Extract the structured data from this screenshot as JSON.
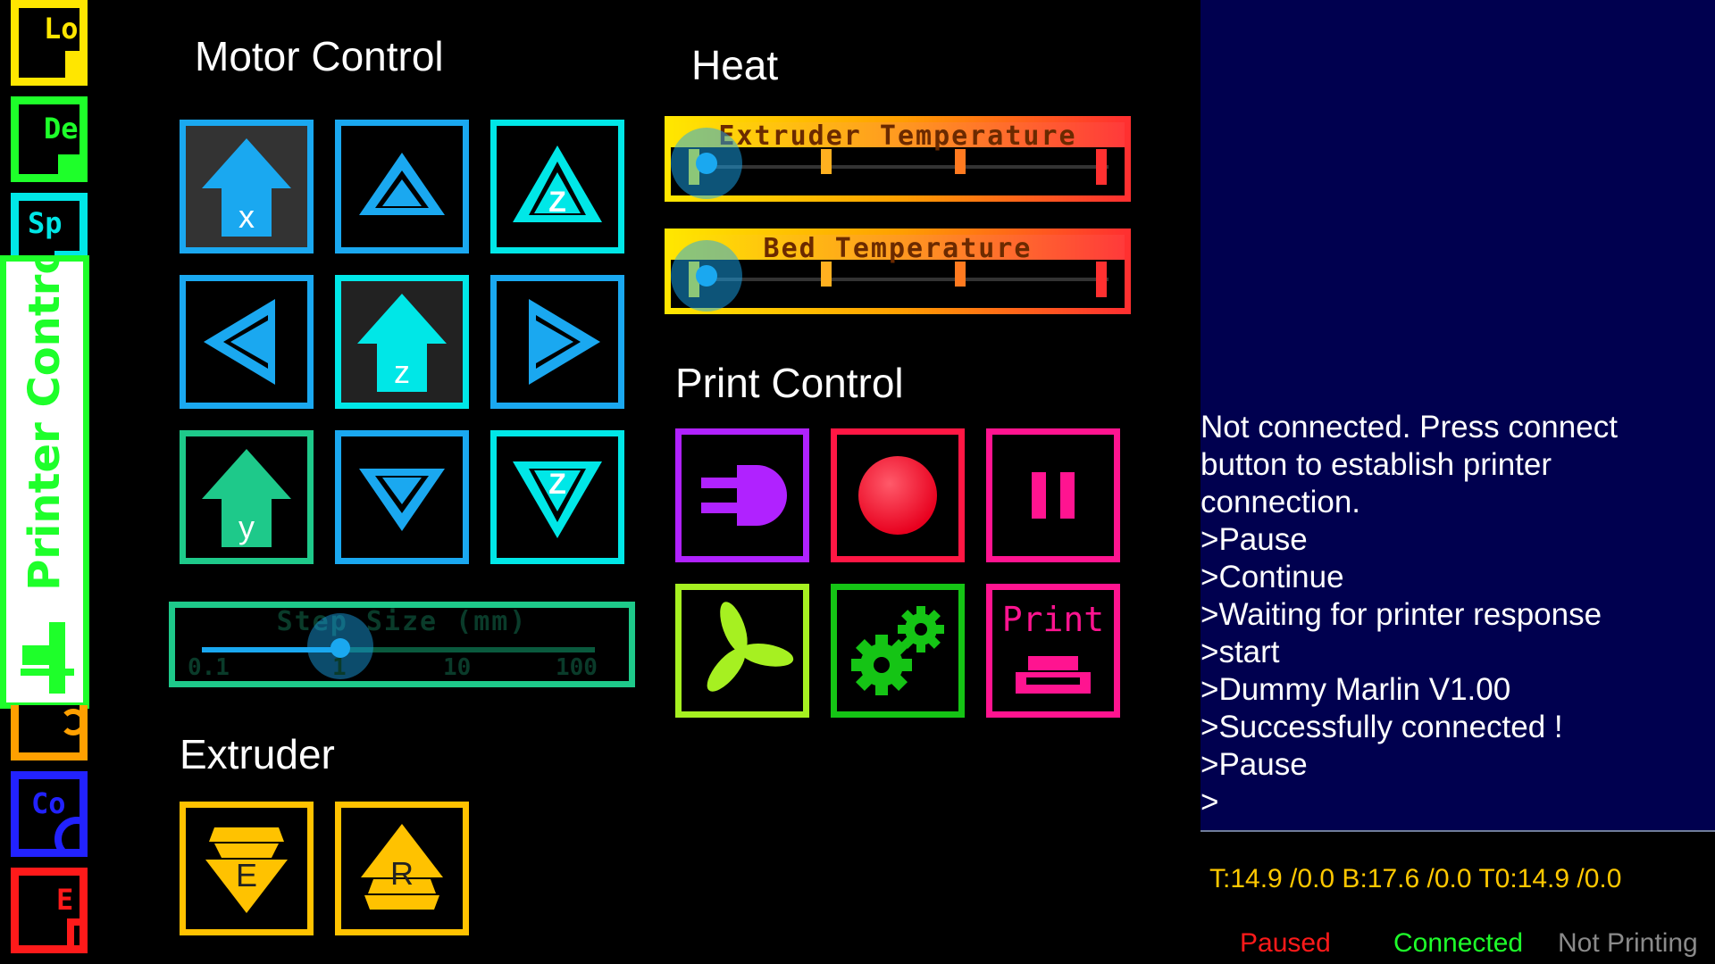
{
  "colors": {
    "motor_blue": "#1aa8f0",
    "motor_cyan": "#00e7e7",
    "motor_green": "#1ec98a",
    "extruder_yellow": "#ffc200",
    "print_purple": "#b022ff",
    "print_red": "#ff1744",
    "print_pink": "#ff1490",
    "print_lime": "#a6f021",
    "print_green": "#15c415",
    "console_bg": "#00004f",
    "temp_text": "#ffc800"
  },
  "sidebar": {
    "tabs": [
      {
        "label": "Lo",
        "color": "#ffe600",
        "icon": "folder-icon"
      },
      {
        "label": "De",
        "color": "#1eff2a",
        "icon": "device-icon"
      },
      {
        "label": "Sp",
        "color": "#00e7e7",
        "icon": "speed-icon"
      },
      {
        "label": "",
        "color": "#ffa000",
        "icon": "refresh-icon"
      },
      {
        "label": "Co",
        "color": "#2222ff",
        "icon": "console-icon"
      },
      {
        "label": "E",
        "color": "#ff1a1a",
        "icon": "exit-icon"
      }
    ],
    "active": {
      "label": "Printer Control",
      "color": "#1eff2a"
    }
  },
  "motor_control": {
    "title": "Motor Control",
    "home_x": "x",
    "home_z": "z",
    "home_y": "y",
    "z_up": "Z",
    "z_down": "Z"
  },
  "step_size": {
    "title": "Step Size (mm)",
    "ticks": [
      "0.1",
      "1",
      "10",
      "100"
    ],
    "selected": "1"
  },
  "extruder": {
    "title": "Extruder",
    "extrude_label": "E",
    "retract_label": "R"
  },
  "heat": {
    "title": "Heat",
    "extruder_temp_label": "Extruder Temperature",
    "bed_temp_label": "Bed Temperature"
  },
  "print_control": {
    "title": "Print Control",
    "print_label": "Print"
  },
  "console": {
    "lines": [
      "Not connected. Press connect",
      "button to establish printer",
      "connection.",
      ">Pause",
      ">Continue",
      ">Waiting for printer response",
      ">start",
      ">Dummy Marlin V1.00",
      ">Successfully connected !",
      ">Pause",
      ">"
    ]
  },
  "temperature_readout": "T:14.9 /0.0 B:17.6 /0.0 T0:14.9 /0.0",
  "status_bar": {
    "paused": {
      "label": "Paused",
      "color": "#ff1a1a"
    },
    "connected": {
      "label": "Connected",
      "color": "#1eff2a"
    },
    "printing": {
      "label": "Not Printing",
      "color": "#8a8a8a"
    }
  }
}
